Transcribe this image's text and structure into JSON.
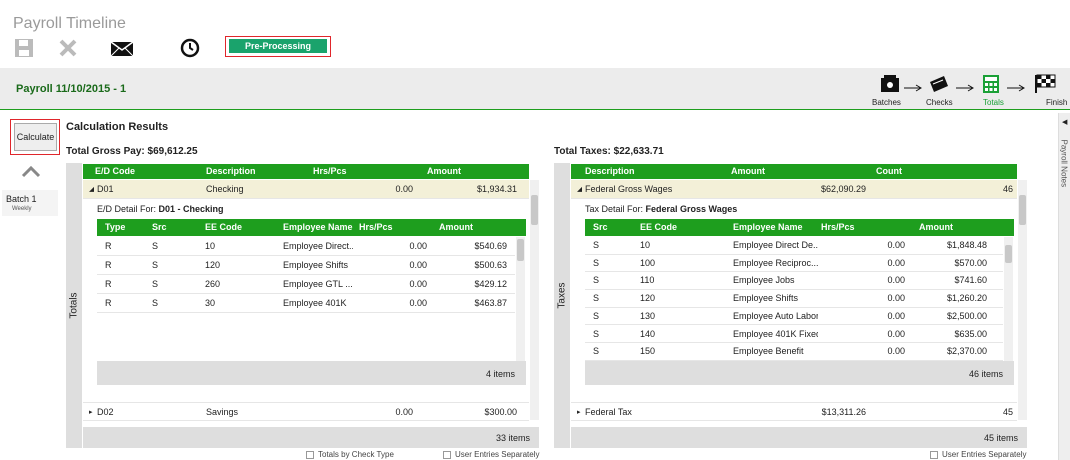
{
  "header": {
    "title": "Payroll Timeline",
    "status_label": "Pre-Processing"
  },
  "payroll": {
    "name": "Payroll 11/10/2015 - 1"
  },
  "workflow": {
    "steps": [
      "Batches",
      "Checks",
      "Totals",
      "Finish"
    ]
  },
  "side_panel": {
    "label": "Payroll Notes"
  },
  "sidebar": {
    "calculate_label": "Calculate",
    "batch_name": "Batch 1",
    "batch_freq": "Weekly"
  },
  "results": {
    "title": "Calculation Results",
    "total_gross": "Total Gross Pay: $69,612.25",
    "total_taxes": "Total Taxes: $22,633.71",
    "totals_vlabel": "Totals",
    "taxes_vlabel": "Taxes"
  },
  "ed_table": {
    "headers": [
      "E/D Code",
      "Description",
      "Hrs/Pcs",
      "Amount"
    ],
    "row1": {
      "code": "D01",
      "desc": "Checking",
      "hrs": "0.00",
      "amt": "$1,934.31"
    },
    "detail_prefix": "E/D Detail For: ",
    "detail_name": "D01 - Checking",
    "detail_headers": [
      "Type",
      "Src",
      "EE Code",
      "Employee Name",
      "Hrs/Pcs",
      "Amount"
    ],
    "detail_rows": [
      [
        "R",
        "S",
        "10",
        "Employee Direct...",
        "0.00",
        "$540.69"
      ],
      [
        "R",
        "S",
        "120",
        "Employee Shifts",
        "0.00",
        "$500.63"
      ],
      [
        "R",
        "S",
        "260",
        "Employee GTL ...",
        "0.00",
        "$429.12"
      ],
      [
        "R",
        "S",
        "30",
        "Employee 401K",
        "0.00",
        "$463.87"
      ]
    ],
    "detail_count": "4 items",
    "row2": {
      "code": "D02",
      "desc": "Savings",
      "hrs": "0.00",
      "amt": "$300.00"
    },
    "count": "33 items"
  },
  "tax_table": {
    "headers": [
      "Description",
      "Amount",
      "Count"
    ],
    "row1": {
      "desc": "Federal Gross Wages",
      "amt": "$62,090.29",
      "count": "46"
    },
    "detail_prefix": "Tax Detail For: ",
    "detail_name": "Federal Gross Wages",
    "detail_headers": [
      "Src",
      "EE Code",
      "Employee Name",
      "Hrs/Pcs",
      "Amount"
    ],
    "detail_rows": [
      [
        "S",
        "10",
        "Employee Direct De...",
        "0.00",
        "$1,848.48"
      ],
      [
        "S",
        "100",
        "Employee Reciproc...",
        "0.00",
        "$570.00"
      ],
      [
        "S",
        "110",
        "Employee Jobs",
        "0.00",
        "$741.60"
      ],
      [
        "S",
        "120",
        "Employee Shifts",
        "0.00",
        "$1,260.20"
      ],
      [
        "S",
        "130",
        "Employee Auto Labor",
        "0.00",
        "$2,500.00"
      ],
      [
        "S",
        "140",
        "Employee 401K Fixed",
        "0.00",
        "$635.00"
      ],
      [
        "S",
        "150",
        "Employee Benefit",
        "0.00",
        "$2,370.00"
      ]
    ],
    "detail_count": "46 items",
    "row2": {
      "desc": "Federal Tax",
      "amt": "$13,311.26",
      "count": "45"
    },
    "count": "45 items"
  },
  "options": {
    "totals_by_check": "Totals by Check Type",
    "user_entries_left": "User Entries Separately",
    "user_entries_right": "User Entries Separately"
  }
}
